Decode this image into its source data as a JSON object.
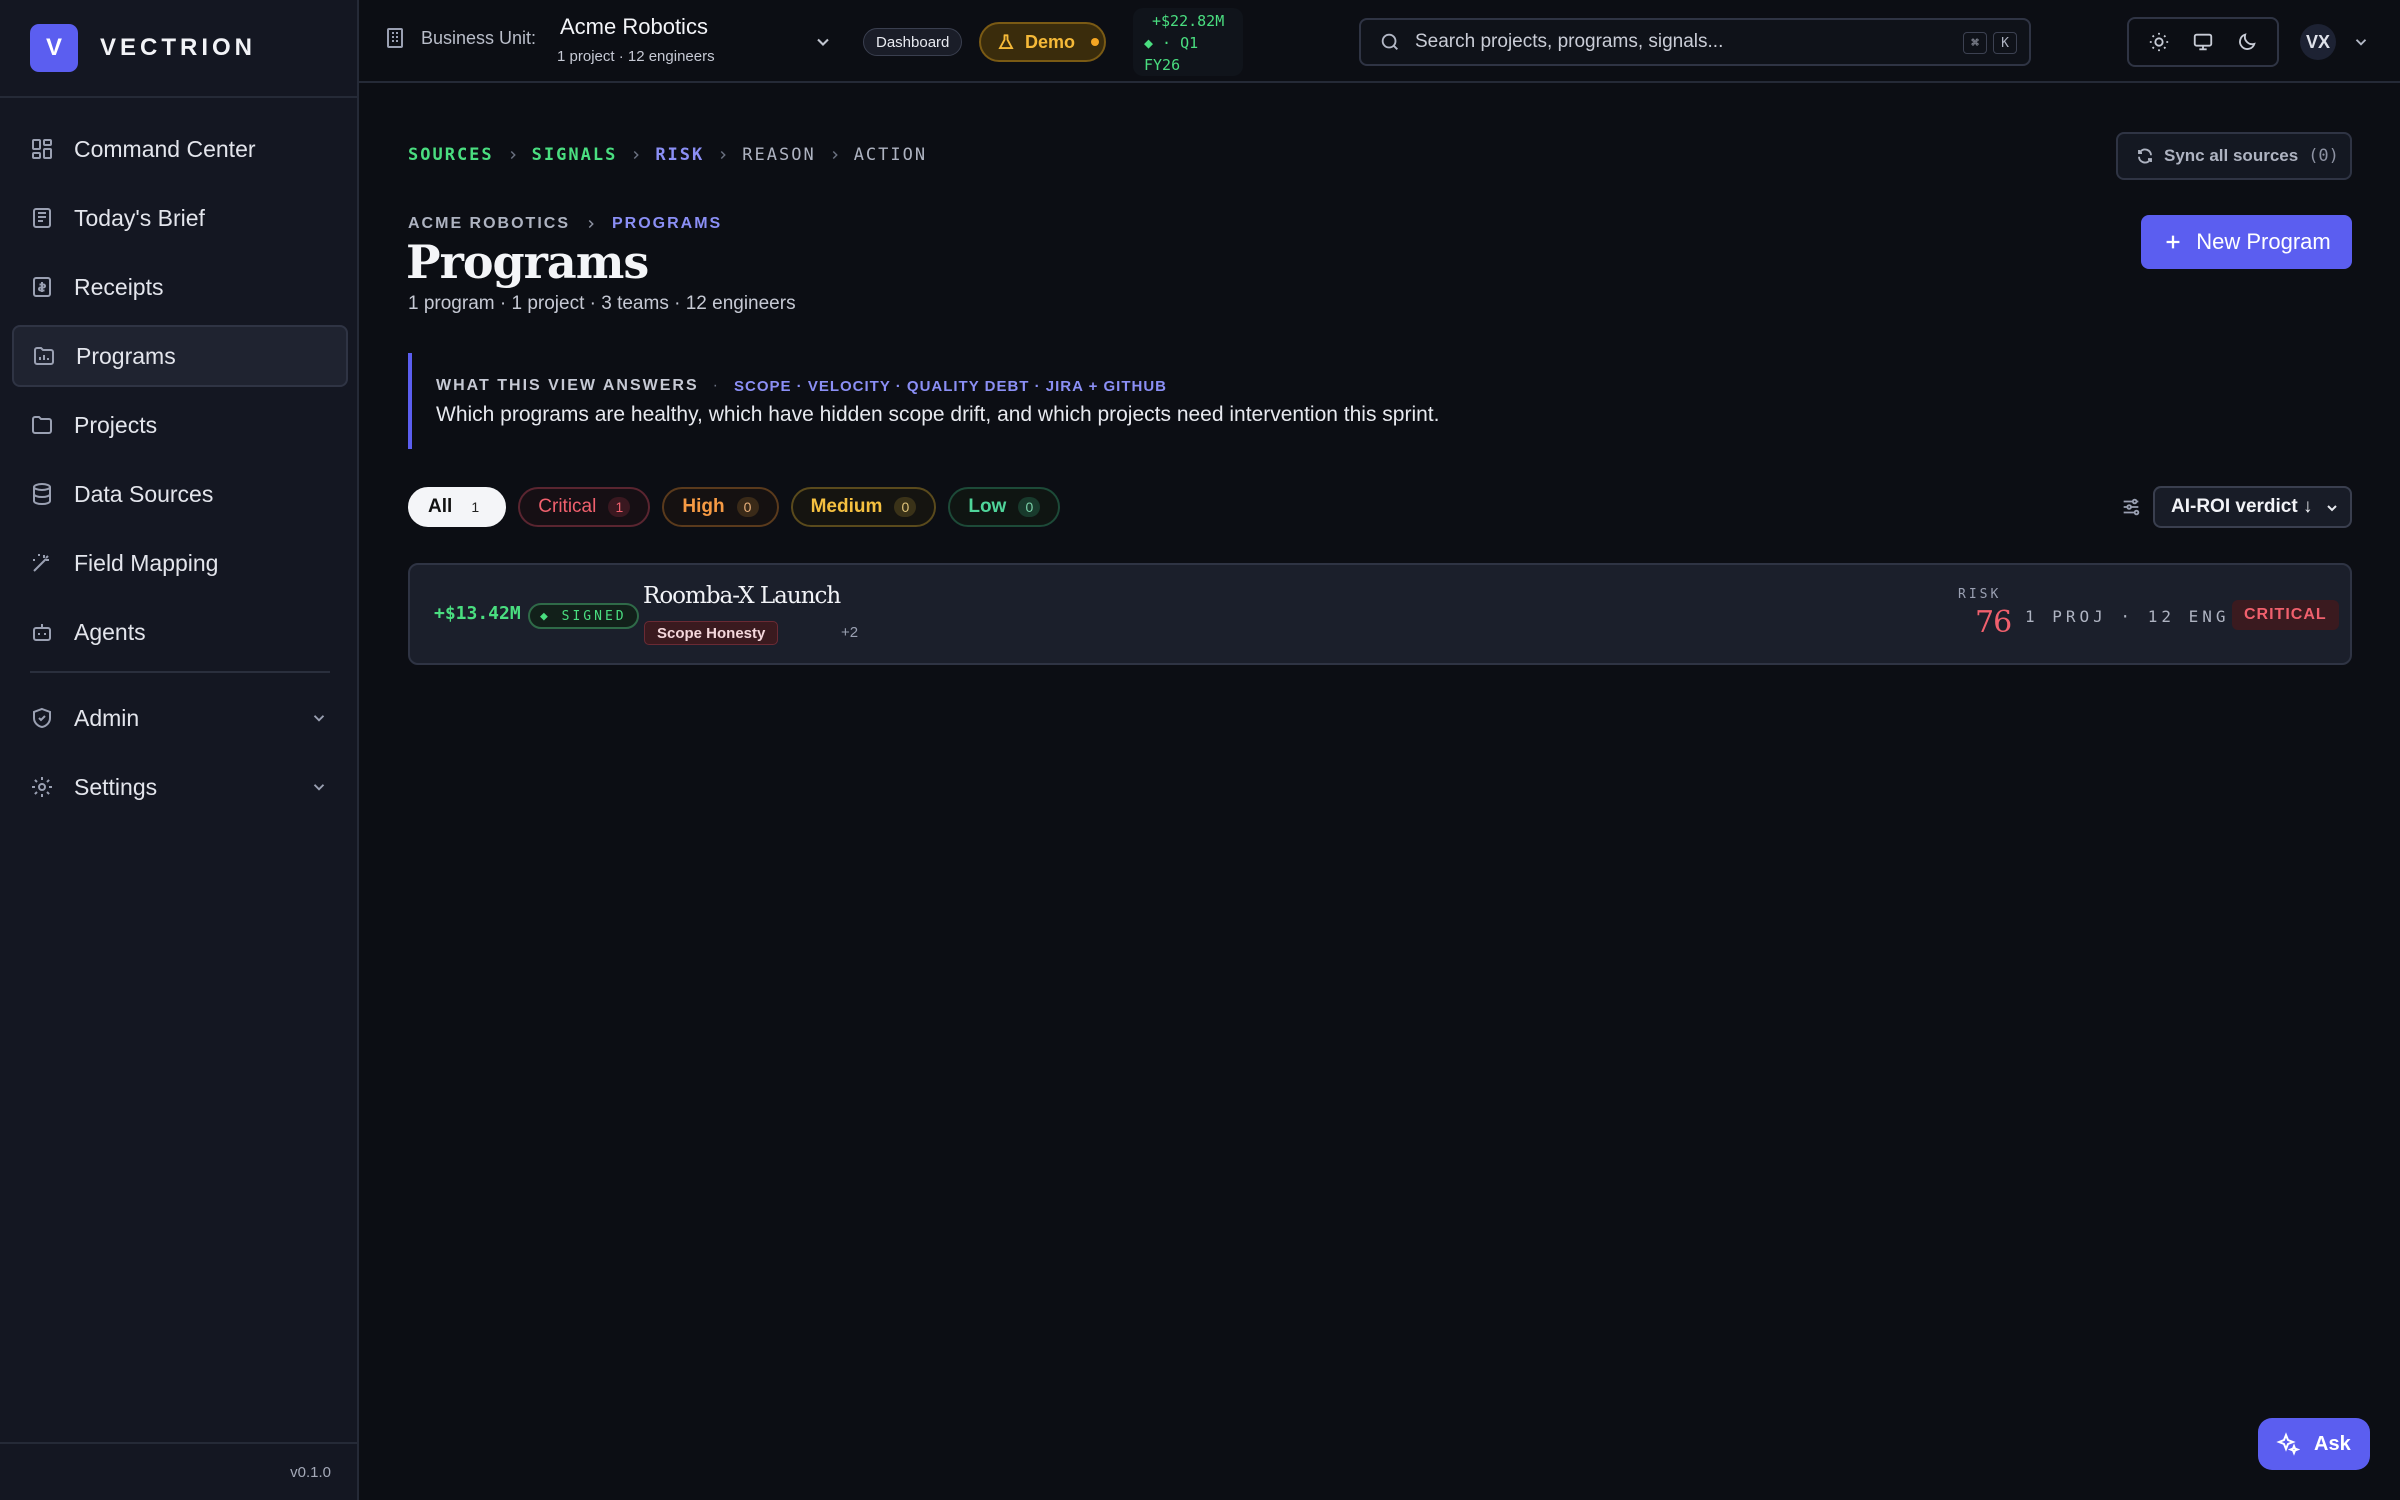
{
  "brand": {
    "logo_letter": "V",
    "name": "VECTRION",
    "accent": "#5b5ef0"
  },
  "sidebar": {
    "items": [
      {
        "label": "Command Center",
        "icon": "layout-grid-icon"
      },
      {
        "label": "Today's Brief",
        "icon": "newspaper-icon"
      },
      {
        "label": "Receipts",
        "icon": "receipt-icon"
      },
      {
        "label": "Programs",
        "icon": "folder-chart-icon",
        "active": true
      },
      {
        "label": "Projects",
        "icon": "folder-icon"
      },
      {
        "label": "Data Sources",
        "icon": "database-icon"
      },
      {
        "label": "Field Mapping",
        "icon": "wand-icon"
      },
      {
        "label": "Agents",
        "icon": "bot-icon"
      }
    ],
    "groups": [
      {
        "label": "Admin",
        "icon": "shield-icon"
      },
      {
        "label": "Settings",
        "icon": "gear-icon"
      }
    ],
    "version": "v0.1.0"
  },
  "header": {
    "bu_label": "Business Unit:",
    "bu_name": "Acme Robotics",
    "bu_sub": "1 project · 12 engineers",
    "dashboard_label": "Dashboard",
    "demo_label": "Demo",
    "roi_line1": "+$22.82M",
    "roi_line2": "◆ · Q1",
    "roi_line3": "FY26",
    "search_placeholder": "Search projects, programs, signals...",
    "kbd_1": "⌘",
    "kbd_2": "K",
    "avatar": "VX"
  },
  "pipeline": [
    {
      "label": "SOURCES",
      "color": "#4ade80"
    },
    {
      "label": "SIGNALS",
      "color": "#4ade80"
    },
    {
      "label": "RISK",
      "color": "#8b8ff5"
    },
    {
      "label": "REASON",
      "color": "#aeb3c1"
    },
    {
      "label": "ACTION",
      "color": "#aeb3c1"
    }
  ],
  "sync": {
    "label": "Sync all sources",
    "count": "(0)"
  },
  "page": {
    "crumb_root": "ACME ROBOTICS",
    "crumb_current": "PROGRAMS",
    "title": "Programs",
    "meta": "1 program · 1 project · 3 teams · 12 engineers",
    "new_button": "New Program"
  },
  "callout": {
    "kicker": "WHAT THIS VIEW ANSWERS",
    "dot": "·",
    "tags": "SCOPE · VELOCITY · QUALITY DEBT · JIRA + GITHUB",
    "text": "Which programs are healthy, which have hidden scope drift, and which projects need intervention this sprint."
  },
  "filters": [
    {
      "label": "All",
      "count": "1",
      "cls": "all"
    },
    {
      "label": "Critical",
      "count": "1",
      "cls": "crit"
    },
    {
      "label": "High",
      "count": "0",
      "cls": "high"
    },
    {
      "label": "Medium",
      "count": "0",
      "cls": "med"
    },
    {
      "label": "Low",
      "count": "0",
      "cls": "low"
    }
  ],
  "sort": {
    "label": "AI-ROI verdict ↓"
  },
  "programs": [
    {
      "roi": "+$13.42M",
      "signed": "◆ SIGNED",
      "name": "Roomba-X Launch",
      "tag": "Scope Honesty",
      "more": "+2",
      "risk_label": "RISK",
      "risk": "76",
      "meta": "1 PROJ · 12 ENG",
      "severity": "CRITICAL"
    }
  ],
  "ask": {
    "label": "Ask"
  }
}
